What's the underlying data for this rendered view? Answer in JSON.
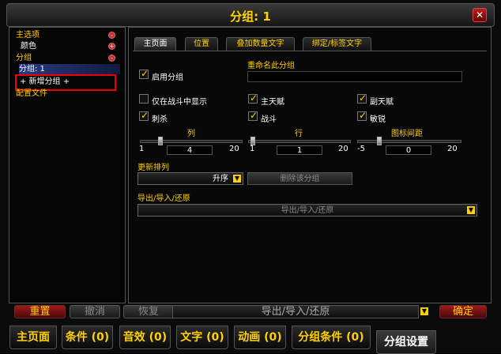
{
  "window": {
    "title": "分组: 1",
    "close": "✕"
  },
  "tree": [
    {
      "label": "主选项",
      "pm": "-"
    },
    {
      "label": "颜色",
      "pm": "+"
    },
    {
      "label": "分组",
      "pm": "-"
    },
    {
      "label": "分组: 1"
    },
    {
      "label": "+ 新增分组 +"
    },
    {
      "label": "配置文件"
    }
  ],
  "tabs": [
    "主页面",
    "位置",
    "叠加数量文字",
    "绑定/标签文字"
  ],
  "enable_group": {
    "label": "启用分组",
    "checked": true
  },
  "rename": {
    "label": "重命名此分组",
    "value": ""
  },
  "checkboxes": [
    {
      "label": "仅在战斗中显示",
      "checked": false
    },
    {
      "label": "主天赋",
      "checked": true
    },
    {
      "label": "副天赋",
      "checked": true
    },
    {
      "label": "刺杀",
      "checked": true
    },
    {
      "label": "战斗",
      "checked": true
    },
    {
      "label": "敏锐",
      "checked": true
    }
  ],
  "sliders": [
    {
      "title": "列",
      "min": "1",
      "max": "20",
      "value": "4"
    },
    {
      "title": "行",
      "min": "1",
      "max": "20",
      "value": "1"
    },
    {
      "title": "图标间距",
      "min": "-5",
      "max": "20",
      "value": "0"
    }
  ],
  "sort": {
    "label": "更新排列",
    "value": "升序",
    "delete_label": "删除该分组"
  },
  "export": {
    "label": "导出/导入/还原",
    "button": "导出/导入/还原"
  },
  "bottom_buttons": {
    "reset": "重置",
    "undo": "撤消",
    "redo": "恢复",
    "export": "导出/导入/还原",
    "ok": "确定"
  },
  "bottom_tabs": [
    "主页面",
    "条件 (0)",
    "音效 (0)",
    "文字 (0)",
    "动画 (0)",
    "分组条件 (0)",
    "分组设置"
  ],
  "colors": {
    "gold": "#ffd100",
    "highlight": "#e00000"
  }
}
